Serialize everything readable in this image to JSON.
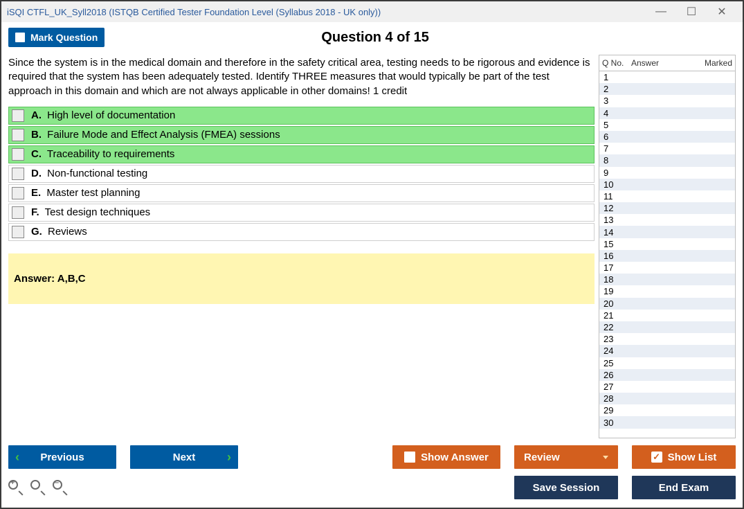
{
  "window": {
    "title": "iSQI CTFL_UK_Syll2018 (ISTQB Certified Tester Foundation Level (Syllabus 2018 - UK only))"
  },
  "header": {
    "mark_label": "Mark Question",
    "question_title": "Question 4 of 15"
  },
  "question": {
    "text": "Since the system is in the medical domain and therefore in the safety critical area, testing needs to be rigorous and evidence is required that the system has been adequately tested. Identify THREE measures that would typically be part of the test approach in this domain and which are not always applicable in other domains! 1 credit",
    "options": [
      {
        "letter": "A.",
        "text": "High level of documentation",
        "correct": true
      },
      {
        "letter": "B.",
        "text": "Failure Mode and Effect Analysis (FMEA) sessions",
        "correct": true
      },
      {
        "letter": "C.",
        "text": "Traceability to requirements",
        "correct": true
      },
      {
        "letter": "D.",
        "text": "Non-functional testing",
        "correct": false
      },
      {
        "letter": "E.",
        "text": "Master test planning",
        "correct": false
      },
      {
        "letter": "F.",
        "text": "Test design techniques",
        "correct": false
      },
      {
        "letter": "G.",
        "text": "Reviews",
        "correct": false
      }
    ],
    "answer_label": "Answer: A,B,C"
  },
  "sidebar": {
    "col_qno": "Q No.",
    "col_answer": "Answer",
    "col_marked": "Marked",
    "rows": [
      1,
      2,
      3,
      4,
      5,
      6,
      7,
      8,
      9,
      10,
      11,
      12,
      13,
      14,
      15,
      16,
      17,
      18,
      19,
      20,
      21,
      22,
      23,
      24,
      25,
      26,
      27,
      28,
      29,
      30
    ]
  },
  "footer": {
    "previous": "Previous",
    "next": "Next",
    "show_answer": "Show Answer",
    "review": "Review",
    "show_list": "Show List",
    "save_session": "Save Session",
    "end_exam": "End Exam"
  }
}
